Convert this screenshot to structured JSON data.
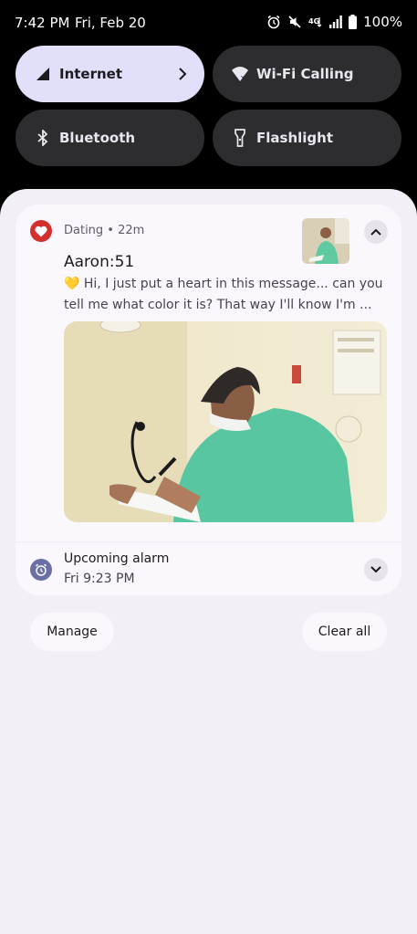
{
  "status_bar": {
    "time": "7:42 PM",
    "date": "Fri, Feb 20",
    "battery": "100%",
    "icons": [
      "alarm-icon",
      "mute-icon",
      "4g-icon",
      "signal-icon",
      "battery-icon"
    ]
  },
  "quick_settings": {
    "tiles": [
      {
        "label": "Internet",
        "icon": "signal-icon",
        "state": "on"
      },
      {
        "label": "Wi-Fi Calling",
        "icon": "wifi-calling-icon",
        "state": "off"
      },
      {
        "label": "Bluetooth",
        "icon": "bluetooth-icon",
        "state": "off"
      },
      {
        "label": "Flashlight",
        "icon": "flashlight-icon",
        "state": "off"
      }
    ]
  },
  "notification": {
    "app_meta": "Dating • 22m",
    "app_icon": "heart-icon",
    "sender": "Aaron:51",
    "message_emoji": "💛",
    "message": " Hi, I just put a heart in this message... can you tell me what color it is? That way I'll know I'm ...",
    "accent": "#d32f2f"
  },
  "alarm": {
    "title": "Upcoming alarm",
    "time": "Fri 9:23 PM",
    "icon": "alarm-clock-icon",
    "accent": "#6b6fa6"
  },
  "actions": {
    "manage": "Manage",
    "clear_all": "Clear all"
  },
  "colors": {
    "tile_active": "#e1dffa",
    "tile_inactive": "#2d2d30",
    "shade_bg": "#f2eff6"
  }
}
